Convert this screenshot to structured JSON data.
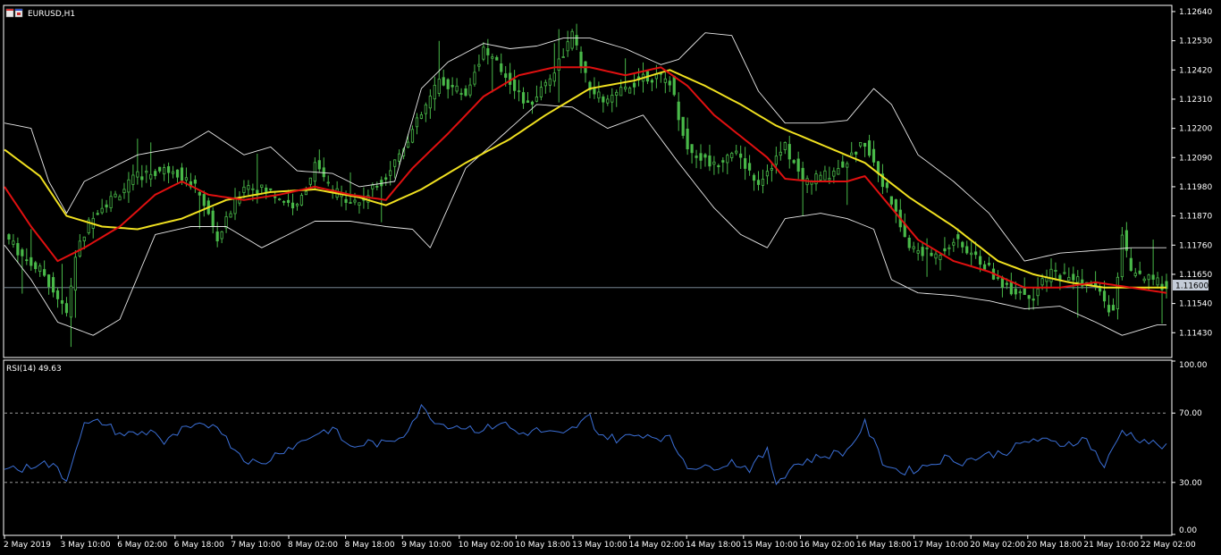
{
  "window": {
    "symbol_label": "EURUSD,H1",
    "icon": "chart-window-icon"
  },
  "rsi_panel": {
    "label": "RSI(14) 49.63"
  },
  "price_marker": "1.11600",
  "colors": {
    "background": "#000000",
    "grid_frame": "#ffffff",
    "candle": "#49b949",
    "bollinger": "#e8e8e8",
    "ma_fast": "#e01010",
    "ma_slow": "#f0e020",
    "rsi_line": "#3b6fd6",
    "level_line": "#b0b0b0",
    "price_line": "#8a9aaa",
    "marker_bg": "#c4ccd8"
  },
  "chart_data": [
    {
      "type": "candlestick",
      "title": "EURUSD,H1",
      "ylim": [
        1.1134,
        1.1266
      ],
      "y_ticks": [
        "1.12640",
        "1.12530",
        "1.12420",
        "1.12310",
        "1.12200",
        "1.12090",
        "1.11980",
        "1.11870",
        "1.11760",
        "1.11650",
        "1.11540",
        "1.11430"
      ],
      "x_ticks": [
        "2 May 2019",
        "3 May 10:00",
        "6 May 02:00",
        "6 May 18:00",
        "7 May 10:00",
        "8 May 02:00",
        "8 May 18:00",
        "9 May 10:00",
        "10 May 02:00",
        "10 May 18:00",
        "13 May 10:00",
        "14 May 02:00",
        "14 May 18:00",
        "15 May 10:00",
        "16 May 02:00",
        "16 May 18:00",
        "17 May 10:00",
        "20 May 02:00",
        "20 May 18:00",
        "21 May 10:00",
        "22 May 02:00"
      ],
      "current_price": 1.116,
      "close_path": [
        [
          0,
          1.118
        ],
        [
          4,
          1.1172
        ],
        [
          9,
          1.1165
        ],
        [
          14,
          1.115
        ],
        [
          16,
          1.1172
        ],
        [
          20,
          1.1188
        ],
        [
          26,
          1.1196
        ],
        [
          30,
          1.1202
        ],
        [
          38,
          1.1205
        ],
        [
          44,
          1.1196
        ],
        [
          48,
          1.1178
        ],
        [
          54,
          1.1199
        ],
        [
          60,
          1.1196
        ],
        [
          66,
          1.119
        ],
        [
          70,
          1.1206
        ],
        [
          74,
          1.1196
        ],
        [
          80,
          1.1192
        ],
        [
          86,
          1.1202
        ],
        [
          94,
          1.1225
        ],
        [
          98,
          1.1238
        ],
        [
          104,
          1.1233
        ],
        [
          108,
          1.125
        ],
        [
          114,
          1.1238
        ],
        [
          118,
          1.1228
        ],
        [
          124,
          1.1242
        ],
        [
          128,
          1.1255
        ],
        [
          132,
          1.1234
        ],
        [
          136,
          1.123
        ],
        [
          144,
          1.124
        ],
        [
          150,
          1.1238
        ],
        [
          154,
          1.1212
        ],
        [
          160,
          1.1206
        ],
        [
          164,
          1.1212
        ],
        [
          170,
          1.12
        ],
        [
          176,
          1.1213
        ],
        [
          180,
          1.12
        ],
        [
          186,
          1.1203
        ],
        [
          190,
          1.1208
        ],
        [
          194,
          1.1215
        ],
        [
          198,
          1.12
        ],
        [
          204,
          1.1175
        ],
        [
          210,
          1.1172
        ],
        [
          214,
          1.1178
        ],
        [
          220,
          1.117
        ],
        [
          226,
          1.116
        ],
        [
          232,
          1.1157
        ],
        [
          236,
          1.1166
        ],
        [
          242,
          1.1163
        ],
        [
          246,
          1.116
        ],
        [
          250,
          1.115
        ],
        [
          252,
          1.118
        ],
        [
          254,
          1.1165
        ],
        [
          260,
          1.1162
        ],
        [
          262,
          1.116
        ]
      ],
      "ma_fast_path": [
        [
          0,
          1.1198
        ],
        [
          6,
          1.1183
        ],
        [
          12,
          1.117
        ],
        [
          18,
          1.1175
        ],
        [
          26,
          1.1183
        ],
        [
          34,
          1.1195
        ],
        [
          40,
          1.12
        ],
        [
          46,
          1.1195
        ],
        [
          54,
          1.1193
        ],
        [
          62,
          1.1195
        ],
        [
          70,
          1.1198
        ],
        [
          78,
          1.1195
        ],
        [
          86,
          1.1193
        ],
        [
          92,
          1.1205
        ],
        [
          100,
          1.1218
        ],
        [
          108,
          1.1232
        ],
        [
          116,
          1.124
        ],
        [
          124,
          1.1243
        ],
        [
          132,
          1.1243
        ],
        [
          140,
          1.124
        ],
        [
          148,
          1.1243
        ],
        [
          154,
          1.1236
        ],
        [
          160,
          1.1225
        ],
        [
          166,
          1.1217
        ],
        [
          172,
          1.1209
        ],
        [
          176,
          1.1201
        ],
        [
          182,
          1.12
        ],
        [
          190,
          1.12
        ],
        [
          194,
          1.1202
        ],
        [
          200,
          1.119
        ],
        [
          206,
          1.1178
        ],
        [
          214,
          1.117
        ],
        [
          222,
          1.1166
        ],
        [
          230,
          1.116
        ],
        [
          238,
          1.116
        ],
        [
          246,
          1.1162
        ],
        [
          254,
          1.116
        ],
        [
          262,
          1.1158
        ]
      ],
      "ma_slow_path": [
        [
          0,
          1.1212
        ],
        [
          8,
          1.1202
        ],
        [
          14,
          1.1187
        ],
        [
          22,
          1.1183
        ],
        [
          30,
          1.1182
        ],
        [
          40,
          1.1186
        ],
        [
          50,
          1.1193
        ],
        [
          60,
          1.1196
        ],
        [
          70,
          1.1197
        ],
        [
          80,
          1.1194
        ],
        [
          86,
          1.1191
        ],
        [
          94,
          1.1197
        ],
        [
          104,
          1.1207
        ],
        [
          114,
          1.1216
        ],
        [
          122,
          1.1225
        ],
        [
          132,
          1.1235
        ],
        [
          142,
          1.1238
        ],
        [
          150,
          1.1242
        ],
        [
          158,
          1.1236
        ],
        [
          166,
          1.1229
        ],
        [
          174,
          1.1221
        ],
        [
          184,
          1.1214
        ],
        [
          194,
          1.1207
        ],
        [
          204,
          1.1194
        ],
        [
          214,
          1.1183
        ],
        [
          224,
          1.117
        ],
        [
          232,
          1.1165
        ],
        [
          240,
          1.1162
        ],
        [
          248,
          1.116
        ],
        [
          256,
          1.116
        ],
        [
          262,
          1.116
        ]
      ],
      "bb_upper_path": [
        [
          0,
          1.1222
        ],
        [
          6,
          1.122
        ],
        [
          10,
          1.12
        ],
        [
          14,
          1.1188
        ],
        [
          18,
          1.12
        ],
        [
          24,
          1.1205
        ],
        [
          30,
          1.121
        ],
        [
          40,
          1.1213
        ],
        [
          46,
          1.1219
        ],
        [
          54,
          1.121
        ],
        [
          60,
          1.1213
        ],
        [
          66,
          1.1204
        ],
        [
          74,
          1.1203
        ],
        [
          80,
          1.1198
        ],
        [
          88,
          1.12
        ],
        [
          94,
          1.1235
        ],
        [
          100,
          1.1245
        ],
        [
          108,
          1.1252
        ],
        [
          114,
          1.125
        ],
        [
          120,
          1.1251
        ],
        [
          126,
          1.1254
        ],
        [
          132,
          1.1254
        ],
        [
          140,
          1.125
        ],
        [
          148,
          1.1244
        ],
        [
          152,
          1.1246
        ],
        [
          158,
          1.1256
        ],
        [
          164,
          1.1255
        ],
        [
          170,
          1.1234
        ],
        [
          176,
          1.1222
        ],
        [
          184,
          1.1222
        ],
        [
          190,
          1.1223
        ],
        [
          196,
          1.1235
        ],
        [
          200,
          1.1229
        ],
        [
          206,
          1.121
        ],
        [
          214,
          1.12
        ],
        [
          222,
          1.1188
        ],
        [
          230,
          1.117
        ],
        [
          238,
          1.1173
        ],
        [
          246,
          1.1174
        ],
        [
          254,
          1.1175
        ],
        [
          260,
          1.1175
        ]
      ],
      "bb_lower_path": [
        [
          0,
          1.1176
        ],
        [
          6,
          1.1163
        ],
        [
          12,
          1.1147
        ],
        [
          20,
          1.1142
        ],
        [
          26,
          1.1148
        ],
        [
          34,
          1.118
        ],
        [
          42,
          1.1183
        ],
        [
          50,
          1.1183
        ],
        [
          58,
          1.1175
        ],
        [
          64,
          1.118
        ],
        [
          70,
          1.1185
        ],
        [
          78,
          1.1185
        ],
        [
          86,
          1.1183
        ],
        [
          92,
          1.1182
        ],
        [
          96,
          1.1175
        ],
        [
          104,
          1.1205
        ],
        [
          112,
          1.1217
        ],
        [
          120,
          1.1229
        ],
        [
          128,
          1.1228
        ],
        [
          136,
          1.122
        ],
        [
          144,
          1.1225
        ],
        [
          152,
          1.1207
        ],
        [
          160,
          1.119
        ],
        [
          166,
          1.118
        ],
        [
          172,
          1.1175
        ],
        [
          176,
          1.1186
        ],
        [
          184,
          1.1188
        ],
        [
          190,
          1.1186
        ],
        [
          196,
          1.1182
        ],
        [
          200,
          1.1163
        ],
        [
          206,
          1.1158
        ],
        [
          214,
          1.1157
        ],
        [
          222,
          1.1155
        ],
        [
          230,
          1.1152
        ],
        [
          238,
          1.1153
        ],
        [
          246,
          1.1147
        ],
        [
          252,
          1.1142
        ],
        [
          260,
          1.1146
        ]
      ]
    },
    {
      "type": "line",
      "title": "RSI(14) 49.63",
      "ylim": [
        0,
        100
      ],
      "y_ticks": [
        "100.00",
        "70.00",
        "30.00",
        "0.00"
      ],
      "levels": [
        70,
        30
      ],
      "rsi_path": [
        [
          0,
          40
        ],
        [
          4,
          37
        ],
        [
          8,
          42
        ],
        [
          12,
          38
        ],
        [
          14,
          31
        ],
        [
          16,
          50
        ],
        [
          18,
          63
        ],
        [
          22,
          65
        ],
        [
          26,
          58
        ],
        [
          30,
          58
        ],
        [
          34,
          60
        ],
        [
          36,
          52
        ],
        [
          40,
          60
        ],
        [
          44,
          62
        ],
        [
          48,
          64
        ],
        [
          50,
          55
        ],
        [
          54,
          44
        ],
        [
          58,
          40
        ],
        [
          62,
          48
        ],
        [
          66,
          52
        ],
        [
          70,
          58
        ],
        [
          74,
          61
        ],
        [
          78,
          50
        ],
        [
          82,
          53
        ],
        [
          86,
          52
        ],
        [
          90,
          58
        ],
        [
          94,
          73
        ],
        [
          98,
          64
        ],
        [
          104,
          62
        ],
        [
          108,
          60
        ],
        [
          112,
          65
        ],
        [
          116,
          58
        ],
        [
          120,
          60
        ],
        [
          126,
          57
        ],
        [
          132,
          68
        ],
        [
          134,
          58
        ],
        [
          138,
          55
        ],
        [
          144,
          58
        ],
        [
          150,
          55
        ],
        [
          154,
          40
        ],
        [
          158,
          38
        ],
        [
          164,
          42
        ],
        [
          168,
          38
        ],
        [
          172,
          48
        ],
        [
          174,
          30
        ],
        [
          178,
          40
        ],
        [
          184,
          45
        ],
        [
          190,
          48
        ],
        [
          194,
          64
        ],
        [
          198,
          42
        ],
        [
          202,
          36
        ],
        [
          206,
          38
        ],
        [
          212,
          44
        ],
        [
          216,
          42
        ],
        [
          220,
          45
        ],
        [
          226,
          48
        ],
        [
          232,
          55
        ],
        [
          238,
          52
        ],
        [
          244,
          55
        ],
        [
          248,
          39
        ],
        [
          252,
          60
        ],
        [
          256,
          55
        ],
        [
          262,
          50
        ]
      ]
    }
  ]
}
